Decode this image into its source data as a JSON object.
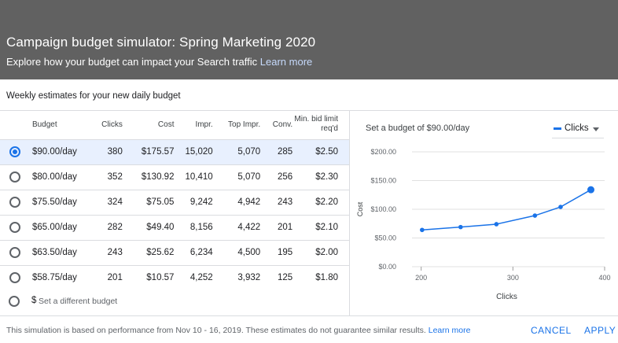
{
  "header": {
    "title": "Campaign budget simulator: Spring Marketing 2020",
    "subtitle": "Explore how your budget can impact your Search traffic",
    "learn_more": "Learn more"
  },
  "weekly_label": "Weekly estimates for your new daily budget",
  "table": {
    "columns": {
      "budget": "Budget",
      "clicks": "Clicks",
      "cost": "Cost",
      "impr": "Impr.",
      "top_impr": "Top Impr.",
      "conv": "Conv.",
      "bid_line1": "Min. bid limit",
      "bid_line2": "req'd"
    },
    "rows": [
      {
        "budget": "$90.00/day",
        "clicks": "380",
        "cost": "$175.57",
        "impr": "15,020",
        "top_impr": "5,070",
        "conv": "285",
        "bid": "$2.50",
        "selected": true
      },
      {
        "budget": "$80.00/day",
        "clicks": "352",
        "cost": "$130.92",
        "impr": "10,410",
        "top_impr": "5,070",
        "conv": "256",
        "bid": "$2.30",
        "selected": false
      },
      {
        "budget": "$75.50/day",
        "clicks": "324",
        "cost": "$75.05",
        "impr": "9,242",
        "top_impr": "4,942",
        "conv": "243",
        "bid": "$2.20",
        "selected": false
      },
      {
        "budget": "$65.00/day",
        "clicks": "282",
        "cost": "$49.40",
        "impr": "8,156",
        "top_impr": "4,422",
        "conv": "201",
        "bid": "$2.10",
        "selected": false
      },
      {
        "budget": "$63.50/day",
        "clicks": "243",
        "cost": "$25.62",
        "impr": "6,234",
        "top_impr": "4,500",
        "conv": "195",
        "bid": "$2.00",
        "selected": false
      },
      {
        "budget": "$58.75/day",
        "clicks": "201",
        "cost": "$10.57",
        "impr": "4,252",
        "top_impr": "3,932",
        "conv": "125",
        "bid": "$1.80",
        "selected": false
      }
    ],
    "different_budget": {
      "prefix": "$",
      "placeholder": "Set a different budget"
    }
  },
  "chart_panel": {
    "heading": "Set a budget of $90.00/day",
    "metric_select": "Clicks",
    "accent": "#1a73e8"
  },
  "chart_data": {
    "type": "line",
    "xlabel": "Clicks",
    "ylabel": "Cost",
    "xlim": [
      190,
      400
    ],
    "ylim": [
      0,
      200
    ],
    "x_ticks": [
      "200",
      "300",
      "400"
    ],
    "y_ticks": [
      "$0.00",
      "$50.00",
      "$100.00",
      "$150.00",
      "$200.00"
    ],
    "x_tick_values": [
      200,
      300,
      400
    ],
    "y_tick_values": [
      0,
      50,
      100,
      150,
      200
    ],
    "grid": true,
    "series": [
      {
        "points": [
          [
            201,
            64
          ],
          [
            243,
            69
          ],
          [
            282,
            74
          ],
          [
            324,
            89
          ],
          [
            352,
            104
          ],
          [
            385,
            134
          ]
        ],
        "highlight_last": true
      }
    ]
  },
  "footer": {
    "note": "This simulation is based on performance from Nov 10 - 16, 2019. These estimates do not guarantee similar results.",
    "learn_more": "Learn more",
    "cancel": "CANCEL",
    "apply": "APPLY"
  }
}
